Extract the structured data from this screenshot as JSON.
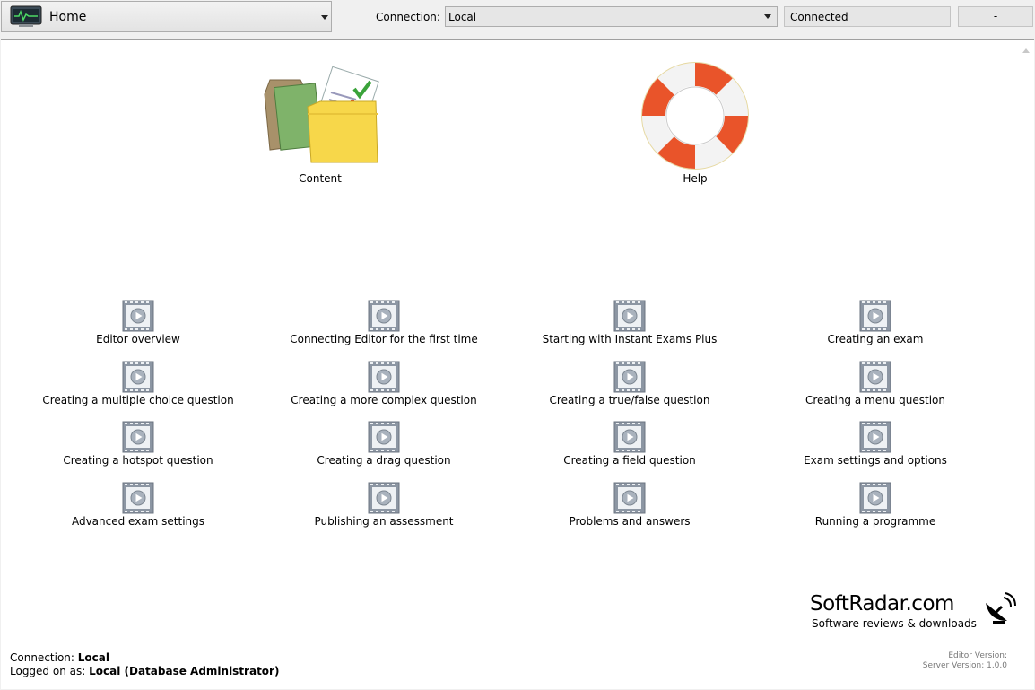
{
  "toolbar": {
    "home_label": "Home",
    "connection_label": "Connection:",
    "connection_value": "Local",
    "status": "Connected",
    "minus_button": "-"
  },
  "tiles": {
    "content": "Content",
    "help": "Help"
  },
  "videos": [
    "Editor overview",
    "Connecting Editor for the first time",
    "Starting with Instant Exams Plus",
    "Creating an exam",
    "Creating a multiple choice question",
    "Creating a more complex question",
    "Creating a true/false question",
    "Creating a menu question",
    "Creating a hotspot question",
    "Creating a drag question",
    "Creating a field question",
    "Exam settings and options",
    "Advanced exam settings",
    "Publishing an assessment",
    "Problems and answers",
    "Running a programme"
  ],
  "footer": {
    "connection_label": "Connection:",
    "connection_value": "Local",
    "logged_label": "Logged on as:",
    "logged_value": "Local (Database Administrator)",
    "editor_version": "Editor Version:",
    "server_version": "Server Version: 1.0.0"
  },
  "watermark": {
    "title": "SoftRadar.com",
    "subtitle": "Software reviews & downloads"
  },
  "colors": {
    "toolbar_bg": "#f0f0f0",
    "panel_bg": "#ffffff",
    "border": "#adadad"
  }
}
